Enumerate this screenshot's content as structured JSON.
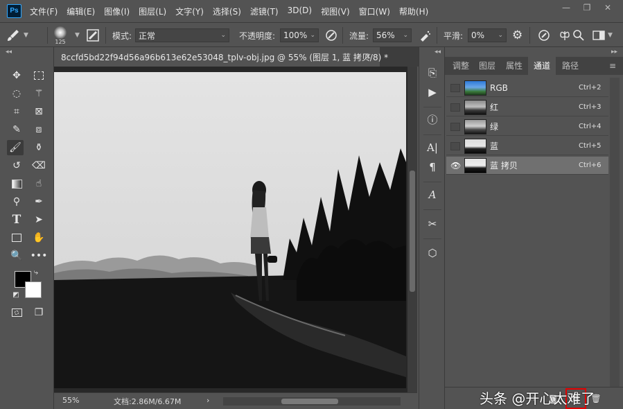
{
  "app": {
    "logo": "Ps"
  },
  "menu": [
    "文件(F)",
    "编辑(E)",
    "图像(I)",
    "图层(L)",
    "文字(Y)",
    "选择(S)",
    "滤镜(T)",
    "3D(D)",
    "视图(V)",
    "窗口(W)",
    "帮助(H)"
  ],
  "window_controls": {
    "minimize": "—",
    "restore": "❐",
    "close": "✕"
  },
  "options": {
    "brush_size": "125",
    "mode_label": "模式:",
    "mode_value": "正常",
    "opacity_label": "不透明度:",
    "opacity_value": "100%",
    "flow_label": "流量:",
    "flow_value": "56%",
    "smoothing_label": "平滑:",
    "smoothing_value": "0%"
  },
  "document": {
    "tab_title": "8ccfd5bd22f94d56a96b613e62e53048_tplv-obj.jpg @ 55% (图层 1, 蓝 拷贝/8) *",
    "close_glyph": "×",
    "zoom": "55%",
    "doc_info": "文档:2.86M/6.67M",
    "status_arrow": "›"
  },
  "panel": {
    "tabs": [
      "调整",
      "图层",
      "属性",
      "通道",
      "路径"
    ],
    "active_tab": "通道",
    "menu_glyph": "≡",
    "channels": [
      {
        "name": "RGB",
        "shortcut": "Ctrl+2",
        "visible": false,
        "selected": false
      },
      {
        "name": "红",
        "shortcut": "Ctrl+3",
        "visible": false,
        "selected": false
      },
      {
        "name": "绿",
        "shortcut": "Ctrl+4",
        "visible": false,
        "selected": false
      },
      {
        "name": "蓝",
        "shortcut": "Ctrl+5",
        "visible": false,
        "selected": false
      },
      {
        "name": "蓝 拷贝",
        "shortcut": "Ctrl+6",
        "visible": true,
        "selected": true
      }
    ]
  },
  "watermark": "头条 @开心太难了",
  "colors": {
    "ui_bg": "#535353",
    "canvas_bg": "#282828",
    "selected_row": "#707070",
    "highlight": "#e00000",
    "ps_blue": "#31a8ff"
  }
}
